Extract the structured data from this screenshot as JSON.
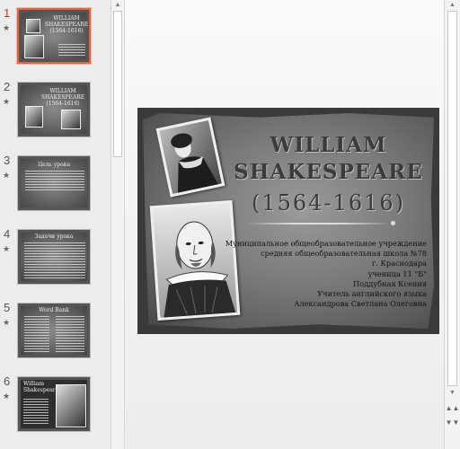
{
  "thumbnails": [
    {
      "num": "1",
      "star": "★",
      "title": "WILLIAM SHAKESPEARE (1564-1616)"
    },
    {
      "num": "2",
      "star": "★",
      "title": "WILLIAM SHAKESPEARE (1564-1616)"
    },
    {
      "num": "3",
      "star": "★",
      "title": "Цель урока"
    },
    {
      "num": "4",
      "star": "★",
      "title": "Задачи урока"
    },
    {
      "num": "5",
      "star": "★",
      "title": "Word Bank"
    },
    {
      "num": "6",
      "star": "★",
      "title": "William Shakespeare"
    }
  ],
  "slide": {
    "title_line1": "WILLIAM",
    "title_line2": "SHAKESPEARE",
    "title_line3": "(1564-1616)",
    "info": [
      "Муниципальное общеобразовательное учреждение",
      "средняя общеобразовательная школа №78",
      "г. Краснодара",
      "ученица 11 \"Б\"",
      "Поддубная Ксения",
      "Учитель английского языка",
      "Александрова Светлана Олеговна"
    ]
  },
  "scroll": {
    "up": "▲",
    "down": "▼",
    "prev_slide": "▲▲",
    "next_slide": "▼▼"
  },
  "colors": {
    "selected_border": "#e1643f",
    "selected_number": "#c43b1d"
  }
}
